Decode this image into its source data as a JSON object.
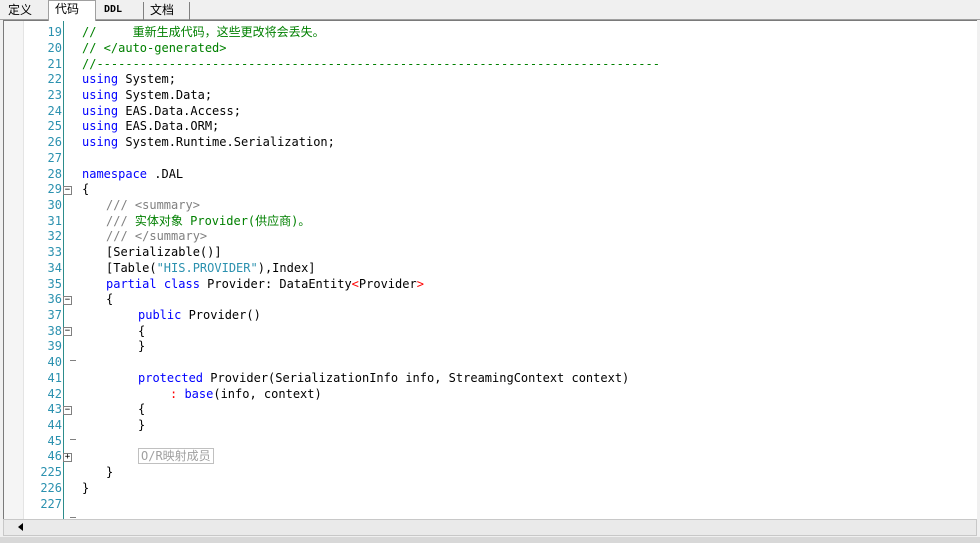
{
  "tabs": [
    {
      "label": "定义",
      "active": false
    },
    {
      "label": "代码",
      "active": true
    },
    {
      "label": "DDL",
      "active": false
    },
    {
      "label": "文档",
      "active": false
    }
  ],
  "gutter": {
    "line_numbers": [
      "19",
      "20",
      "21",
      "22",
      "23",
      "24",
      "25",
      "26",
      "27",
      "28",
      "29",
      "30",
      "31",
      "32",
      "33",
      "34",
      "35",
      "36",
      "37",
      "38",
      "39",
      "40",
      "41",
      "42",
      "43",
      "44",
      "45",
      "46",
      "225",
      "226",
      "227"
    ]
  },
  "code": {
    "l19": "//     重新生成代码，这些更改将会丢失。",
    "l20": "// </auto-generated>",
    "l21": "//------------------------------------------------------------------------------",
    "using_kw": "using",
    "l22": " System;",
    "l23": " System.Data;",
    "l24": " EAS.Data.Access;",
    "l25": " EAS.Data.ORM;",
    "l26": " System.Runtime.Serialization;",
    "namespace_kw": "namespace",
    "l28": " .DAL",
    "l29": "{",
    "l30_slashes": "///",
    "l30_tag": " <summary>",
    "l31_slashes": "///",
    "l31_text": " 实体对象 Provider(供应商)。",
    "l32_slashes": "///",
    "l32_tag": " </summary>",
    "l33": "[Serializable()]",
    "l34_a": "[Table(",
    "l34_str": "\"HIS.PROVIDER\"",
    "l34_b": "),Index]",
    "partial_kw": "partial",
    "class_kw": "class",
    "l35_name": " Provider: ",
    "l35_base": "DataEntity",
    "l35_lt": "<",
    "l35_gen": "Provider",
    "l35_gt": ">",
    "l36": "{",
    "public_kw": "public",
    "l37_rest": " Provider()",
    "l38": "{",
    "l39": "}",
    "protected_kw": "protected",
    "l41_rest": " Provider(SerializationInfo info, StreamingContext context)",
    "l42_colon": ": ",
    "base_kw": "base",
    "l42_rest": "(info, context)",
    "l43": "{",
    "l44": "}",
    "l46_region": "O/R映射成员",
    "l225": "}",
    "l226": "}"
  }
}
